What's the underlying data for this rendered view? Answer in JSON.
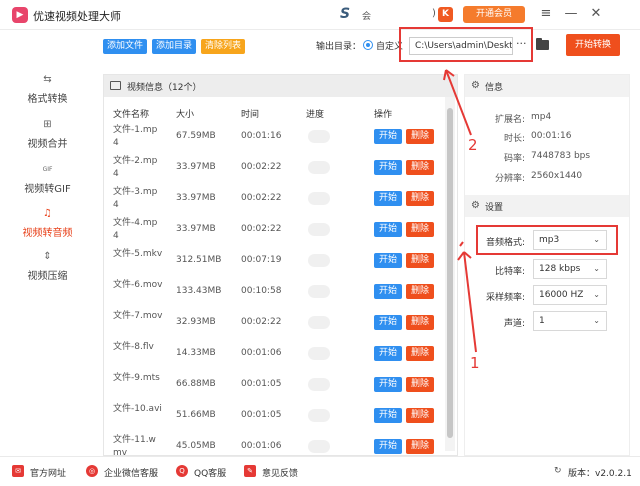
{
  "app": {
    "title": "优速视频处理大师",
    "tb_user": "会",
    "tb_paren": ")",
    "tb_k": "K",
    "vip_label": "开通会员"
  },
  "toolbar": {
    "add_file": "添加文件",
    "add_dir": "添加目录",
    "clear_list": "清除列表",
    "output_label": "输出目录：",
    "custom_label": "自定义",
    "path_value": "C:\\Users\\admin\\Desktop",
    "start_convert": "开始转换"
  },
  "sidebar": {
    "items": [
      {
        "label": "格式转换",
        "icon": "⇆"
      },
      {
        "label": "视频合并",
        "icon": "⊞"
      },
      {
        "label": "视频转GIF",
        "icon": "GIF"
      },
      {
        "label": "视频转音频",
        "icon": "♫"
      },
      {
        "label": "视频压缩",
        "icon": "⇕"
      }
    ]
  },
  "panel": {
    "header": "视频信息（12个）",
    "col_name": "文件名称",
    "col_size": "大小",
    "col_time": "时间",
    "col_progress": "进度",
    "col_action": "操作",
    "start_label": "开始",
    "delete_label": "删除",
    "rows": [
      {
        "name": "文件-1.mp4",
        "size": "67.59MB",
        "time": "00:01:16"
      },
      {
        "name": "文件-2.mp4",
        "size": "33.97MB",
        "time": "00:02:22"
      },
      {
        "name": "文件-3.mp4",
        "size": "33.97MB",
        "time": "00:02:22"
      },
      {
        "name": "文件-4.mp4",
        "size": "33.97MB",
        "time": "00:02:22"
      },
      {
        "name": "文件-5.mkv",
        "size": "312.51MB",
        "time": "00:07:19"
      },
      {
        "name": "文件-6.mov",
        "size": "133.43MB",
        "time": "00:10:58"
      },
      {
        "name": "文件-7.mov",
        "size": "32.93MB",
        "time": "00:02:22"
      },
      {
        "name": "文件-8.flv",
        "size": "14.33MB",
        "time": "00:01:06"
      },
      {
        "name": "文件-9.mts",
        "size": "66.88MB",
        "time": "00:01:05"
      },
      {
        "name": "文件-10.avi",
        "size": "51.66MB",
        "time": "00:01:05"
      },
      {
        "name": "文件-11.wmv",
        "size": "45.05MB",
        "time": "00:01:06"
      }
    ]
  },
  "info": {
    "header": "信息",
    "ext_label": "扩展名:",
    "ext_value": "mp4",
    "dur_label": "时长:",
    "dur_value": "00:01:16",
    "bitrate_label": "码率:",
    "bitrate_value": "7448783 bps",
    "res_label": "分辨率:",
    "res_value": "2560x1440"
  },
  "settings": {
    "header": "设置",
    "format_label": "音频格式:",
    "format_value": "mp3",
    "bitrate_label": "比特率:",
    "bitrate_value": "128 kbps",
    "samplerate_label": "采样频率:",
    "samplerate_value": "16000 HZ",
    "channel_label": "声道:",
    "channel_value": "1"
  },
  "annotations": {
    "one": "1",
    "two": "2"
  },
  "footer": {
    "website": "官方网址",
    "wechat": "企业微信客服",
    "qq": "QQ客服",
    "feedback": "意见反馈",
    "version": "版本：v2.0.2.1"
  }
}
